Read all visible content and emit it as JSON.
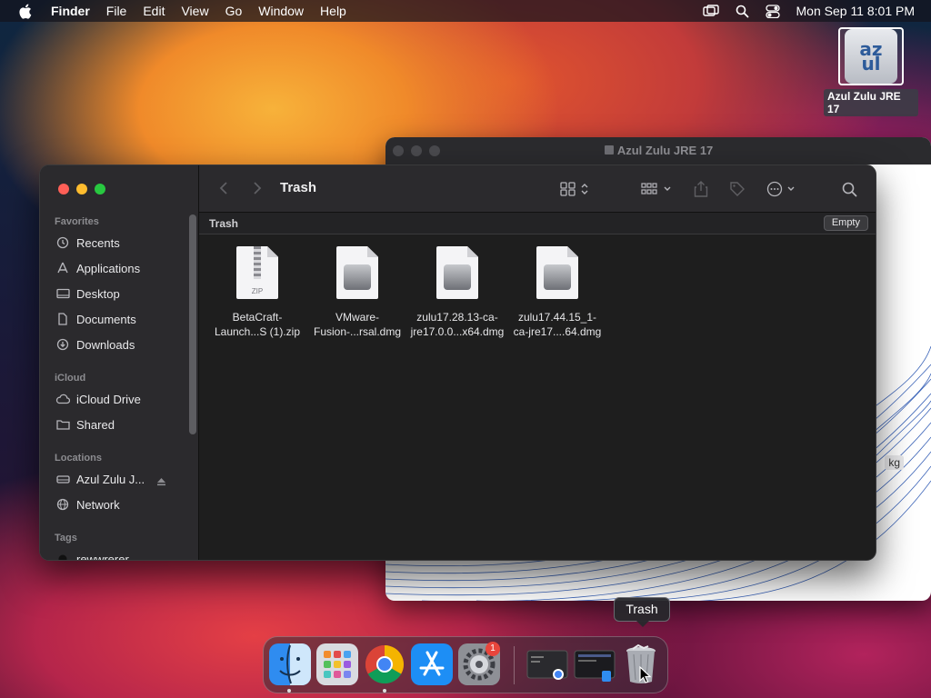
{
  "menubar": {
    "app_name": "Finder",
    "menus": [
      "File",
      "Edit",
      "View",
      "Go",
      "Window",
      "Help"
    ],
    "clock": "Mon Sep 11  8:01 PM"
  },
  "desktop": {
    "disk_label": "Azul Zulu JRE 17",
    "disk_glyph": "az\nul"
  },
  "background_window": {
    "title": "Azul Zulu JRE 17",
    "partial_label": "kg"
  },
  "finder": {
    "title": "Trash",
    "path_label": "Trash",
    "empty_button": "Empty",
    "sidebar": {
      "favorites_title": "Favorites",
      "favorites": [
        "Recents",
        "Applications",
        "Desktop",
        "Documents",
        "Downloads"
      ],
      "icloud_title": "iCloud",
      "icloud": [
        "iCloud Drive",
        "Shared"
      ],
      "locations_title": "Locations",
      "locations": [
        "Azul Zulu J...",
        "Network"
      ],
      "tags_title": "Tags",
      "tags": [
        "rewwrerer"
      ]
    },
    "files": [
      {
        "name": "BetaCraft-\nLaunch...S (1).zip",
        "kind": "zip",
        "zip_text": "ZIP"
      },
      {
        "name": "VMware-\nFusion-...rsal.dmg",
        "kind": "dmg"
      },
      {
        "name": "zulu17.28.13-ca-\njre17.0.0...x64.dmg",
        "kind": "dmg"
      },
      {
        "name": "zulu17.44.15_1-\nca-jre17....64.dmg",
        "kind": "dmg"
      }
    ]
  },
  "dock": {
    "tooltip": "Trash",
    "apps": [
      "finder-app",
      "launchpad-app",
      "chrome-app",
      "app-store-app",
      "system-settings-app",
      "finder-window-thumb",
      "chrome-window-thumb",
      "trash-app"
    ],
    "settings_badge": "1"
  },
  "colors": {
    "close": "#ff5f57",
    "minimize": "#febc2e",
    "zoom": "#28c840"
  }
}
